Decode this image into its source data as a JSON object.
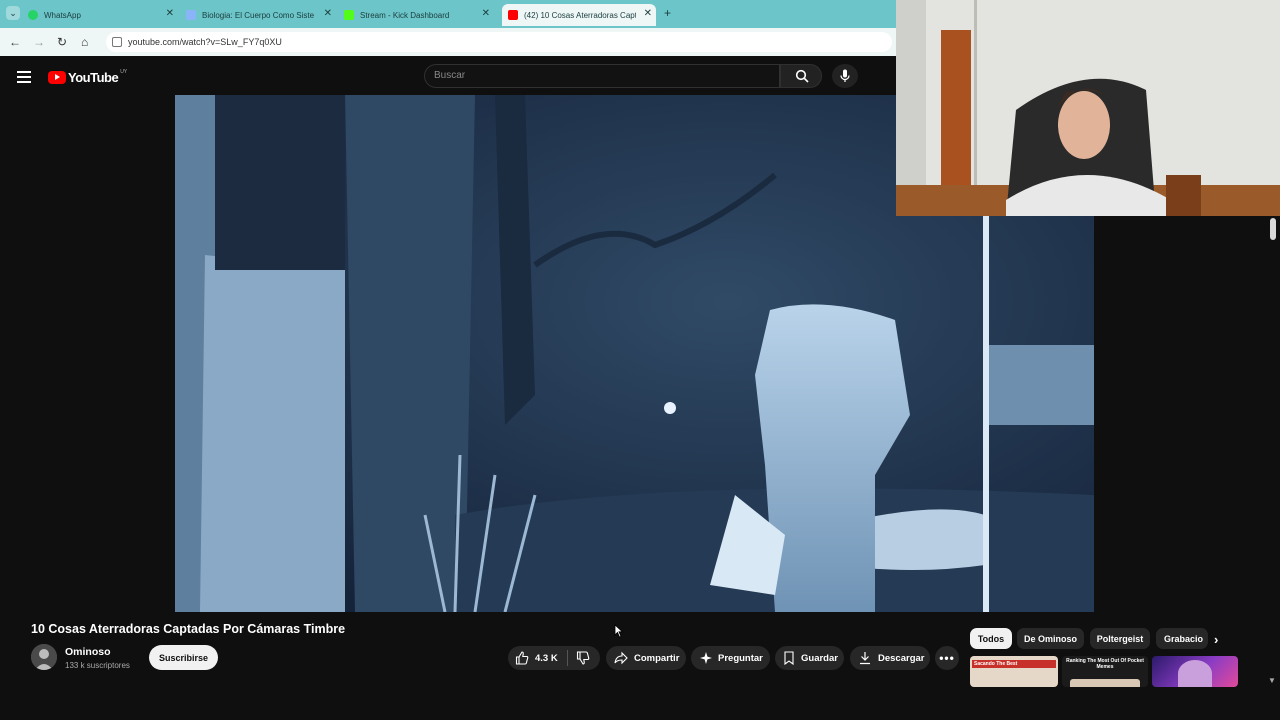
{
  "browser": {
    "tabs": [
      {
        "title": "WhatsApp",
        "favicon_color": "#25d366"
      },
      {
        "title": "Biologia: El Cuerpo Como Siste",
        "favicon_color": "#8ab4f8"
      },
      {
        "title": "Stream - Kick Dashboard",
        "favicon_color": "#53fc18"
      },
      {
        "title": "(42) 10 Cosas Aterradoras Capt",
        "favicon_color": "#ff0000"
      }
    ],
    "new_tab_label": "+",
    "tab_menu_label": "⌄",
    "url": "youtube.com/watch?v=SLw_FY7q0XU"
  },
  "youtube": {
    "logo_text": "YouTube",
    "country_code": "UY",
    "search_placeholder": "Buscar"
  },
  "video": {
    "title": "10 Cosas Aterradoras Captadas Por Cámaras Timbre",
    "channel": "Ominoso",
    "subscribers": "133 k suscriptores",
    "subscribe_label": "Suscribirse",
    "likes": "4.3 K",
    "actions": {
      "share": "Compartir",
      "ask": "Preguntar",
      "save": "Guardar",
      "download": "Descargar"
    }
  },
  "chips": [
    "Todos",
    "De Ominoso",
    "Poltergeist",
    "Grabacio"
  ],
  "thumbnails": [
    {
      "caption": "Sacando The Best"
    },
    {
      "caption": "Ranking The Most Out Of Pocket Memes"
    }
  ],
  "colors": {
    "accent": "#ff0000",
    "tabbar": "#6cc5c8",
    "background": "#0f0f0f"
  }
}
